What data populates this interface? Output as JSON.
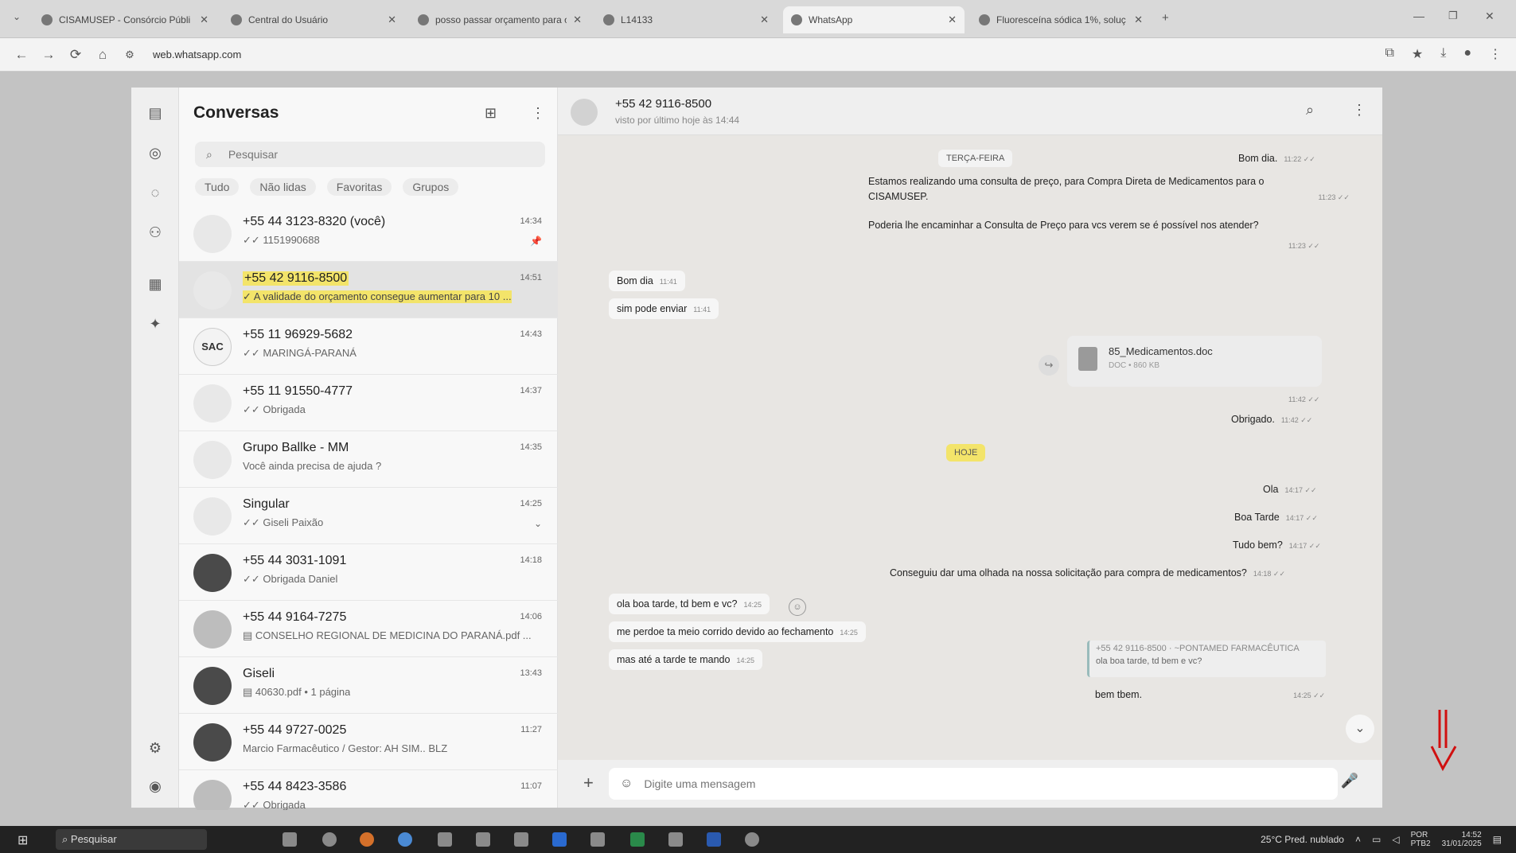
{
  "browser": {
    "tabs": [
      {
        "label": "CISAMUSEP - Consórcio Públi"
      },
      {
        "label": "Central do Usuário"
      },
      {
        "label": "posso passar orçamento para o"
      },
      {
        "label": "L14133"
      },
      {
        "label": "WhatsApp"
      },
      {
        "label": "Fluoresceína sódica 1%, soluç"
      }
    ],
    "new_tab": "+",
    "url": "web.whatsapp.com"
  },
  "sidebar": {
    "title": "Conversas",
    "search_placeholder": "Pesquisar",
    "filters": [
      "Tudo",
      "Não lidas",
      "Favoritas",
      "Grupos"
    ],
    "chats": [
      {
        "name": "+55 44 3123-8320 (você)",
        "preview": "✓✓ 1151990688",
        "time": "14:34",
        "extra": "📌"
      },
      {
        "name": "+55 42 9116-8500",
        "preview": "✓ A validade do orçamento consegue aumentar para 10 ...",
        "time": "14:51",
        "extra": ""
      },
      {
        "name": "+55 11 96929-5682",
        "preview": "✓✓ MARINGÁ-PARANÁ",
        "time": "14:43",
        "extra": ""
      },
      {
        "name": "+55 11 91550-4777",
        "preview": "✓✓ Obrigada",
        "time": "14:37",
        "extra": ""
      },
      {
        "name": "Grupo Ballke - MM",
        "preview": "Você ainda precisa de ajuda ?",
        "time": "14:35",
        "extra": ""
      },
      {
        "name": "Singular",
        "preview": "✓✓ Giseli Paixão",
        "time": "14:25",
        "extra": "⌄"
      },
      {
        "name": "+55 44 3031-1091",
        "preview": "✓✓ Obrigada Daniel",
        "time": "14:18",
        "extra": ""
      },
      {
        "name": "+55 44 9164-7275",
        "preview": "▤ CONSELHO REGIONAL DE MEDICINA DO PARANÁ.pdf ...",
        "time": "14:06",
        "extra": ""
      },
      {
        "name": "Giseli",
        "preview": "▤ 40630.pdf • 1 página",
        "time": "13:43",
        "extra": ""
      },
      {
        "name": "+55 44 9727-0025",
        "preview": "Marcio Farmacêutico / Gestor: AH SIM.. BLZ",
        "time": "11:27",
        "extra": ""
      },
      {
        "name": "+55 44 8423-3586",
        "preview": "✓✓ Obrigada",
        "time": "11:07",
        "extra": ""
      }
    ]
  },
  "chat": {
    "name": "+55 42 9116-8500",
    "status": "visto por último hoje às 14:44",
    "dates": [
      "TERÇA-FEIRA",
      "HOJE"
    ],
    "messages": [
      {
        "text": "Bom dia.",
        "time": "11:22 ✓✓"
      },
      {
        "text": "Estamos realizando uma consulta de preço, para Compra Direta de Medicamentos para o",
        "time": ""
      },
      {
        "text": "CISAMUSEP.",
        "time": "11:23 ✓✓"
      },
      {
        "text": "Poderia lhe encaminhar a Consulta de Preço para vcs verem se é possível nos atender?",
        "time": "11:23 ✓✓"
      },
      {
        "text": "Bom dia",
        "time": "11:41"
      },
      {
        "text": "sim pode enviar",
        "time": "11:41"
      },
      {
        "text": "Obrigado.",
        "time": "11:42 ✓✓"
      },
      {
        "text": "Ola",
        "time": "14:17 ✓✓"
      },
      {
        "text": "Boa Tarde",
        "time": "14:17 ✓✓"
      },
      {
        "text": "Tudo bem?",
        "time": "14:17 ✓✓"
      },
      {
        "text": "Conseguiu dar uma olhada na nossa solicitação para compra de medicamentos?",
        "time": "14:18 ✓✓"
      },
      {
        "text": "ola boa tarde, td bem e vc?",
        "time": "14:25"
      },
      {
        "text": "me perdoe ta meio corrido devido ao fechamento",
        "time": "14:25"
      },
      {
        "text": "mas até a tarde te mando",
        "time": "14:25"
      },
      {
        "text": "bem tbem.",
        "time": "14:25 ✓✓"
      }
    ],
    "file": {
      "name": "85_Medicamentos.doc",
      "meta": "DOC • 860 KB",
      "time": "11:42 ✓✓"
    },
    "quote": {
      "author": "+55 42 9116-8500 · ~PONTAMED FARMACÊUTICA",
      "text": "ola boa tarde, td bem e vc?"
    },
    "composer_placeholder": "Digite uma mensagem"
  },
  "taskbar": {
    "search": "Pesquisar",
    "weather": "25°C  Pred. nublado",
    "lang": "POR\nPTB2",
    "time": "14:52",
    "date": "31/01/2025"
  },
  "colors": {
    "highlight": "#f3e46a",
    "annotation_arrow": "#d01010"
  }
}
